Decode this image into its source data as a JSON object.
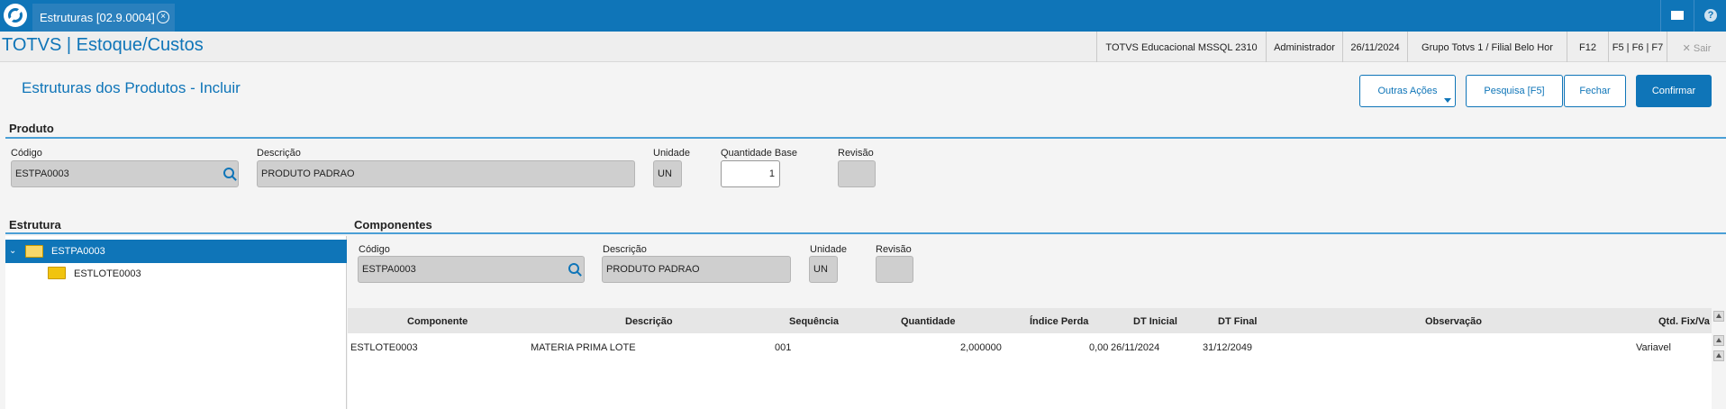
{
  "topbar": {
    "tab_title": "Estruturas [02.9.0004]",
    "tab_close": "×"
  },
  "subbar": {
    "app_title": "TOTVS | Estoque/Custos",
    "environment": "TOTVS Educacional MSSQL 2310",
    "user": "Administrador",
    "date": "26/11/2024",
    "branch": "Grupo Totvs 1 / Filial Belo Hor",
    "f12": "F12",
    "shortcuts": "F5 | F6 | F7",
    "exit": "✕  Sair"
  },
  "page": {
    "title": "Estruturas dos Produtos - Incluir",
    "buttons": {
      "outras_acoes": "Outras Ações",
      "pesquisa": "Pesquisa [F5]",
      "fechar": "Fechar",
      "confirmar": "Confirmar"
    }
  },
  "produto": {
    "section": "Produto",
    "codigo_label": "Código",
    "codigo_value": "ESTPA0003",
    "descricao_label": "Descrição",
    "descricao_value": "PRODUTO PADRAO",
    "unidade_label": "Unidade",
    "unidade_value": "UN",
    "qtd_base_label": "Quantidade Base",
    "qtd_base_value": "1",
    "revisao_label": "Revisão",
    "revisao_value": ""
  },
  "estrutura": {
    "section": "Estrutura",
    "root": "ESTPA0003",
    "child": "ESTLOTE0003"
  },
  "componentes": {
    "section": "Componentes",
    "codigo_label": "Código",
    "codigo_value": "ESTPA0003",
    "descricao_label": "Descrição",
    "descricao_value": "PRODUTO PADRAO",
    "unidade_label": "Unidade",
    "unidade_value": "UN",
    "revisao_label": "Revisão",
    "revisao_value": ""
  },
  "grid": {
    "headers": {
      "componente": "Componente",
      "descricao": "Descrição",
      "sequencia": "Sequência",
      "quantidade": "Quantidade",
      "indice_perda": "Índice Perda",
      "dt_inicial": "DT Inicial",
      "dt_final": "DT Final",
      "observacao": "Observação",
      "qtd_fix_var": "Qtd. Fix/Va"
    },
    "rows": [
      {
        "componente": "ESTLOTE0003",
        "descricao": "MATERIA PRIMA LOTE",
        "sequencia": "001",
        "quantidade": "2,000000",
        "indice_perda": "0,00",
        "dt_inicial": "26/11/2024",
        "dt_final": "31/12/2049",
        "observacao": "",
        "qtd_fix_var": "Variavel"
      }
    ]
  },
  "colors": {
    "primary": "#0f75b8",
    "section_line": "#4a9fd6",
    "readonly_field": "#cfcfcf"
  }
}
